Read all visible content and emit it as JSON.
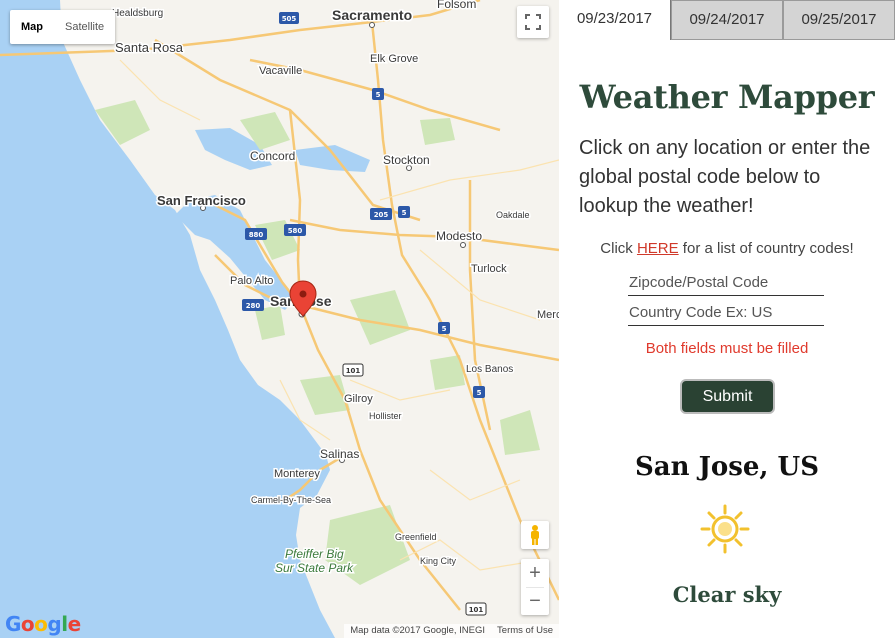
{
  "map": {
    "map_type_buttons": [
      "Map",
      "Satellite"
    ],
    "cities": [
      {
        "name": "Sacramento",
        "style": "big"
      },
      {
        "name": "Folsom",
        "style": "med"
      },
      {
        "name": "Santa Rosa",
        "style": "med"
      },
      {
        "name": "Vacaville",
        "style": "small"
      },
      {
        "name": "Elk Grove",
        "style": "small"
      },
      {
        "name": "Concord",
        "style": "med"
      },
      {
        "name": "Stockton",
        "style": "med"
      },
      {
        "name": "San Francisco",
        "style": "big"
      },
      {
        "name": "Modesto",
        "style": "med"
      },
      {
        "name": "Oakdale",
        "style": "tiny"
      },
      {
        "name": "Turlock",
        "style": "small"
      },
      {
        "name": "Palo Alto",
        "style": "small"
      },
      {
        "name": "San Jose",
        "style": "big"
      },
      {
        "name": "Merced",
        "style": "small"
      },
      {
        "name": "Los Banos",
        "style": "small"
      },
      {
        "name": "Gilroy",
        "style": "small"
      },
      {
        "name": "Hollister",
        "style": "tiny"
      },
      {
        "name": "Salinas",
        "style": "med"
      },
      {
        "name": "Monterey",
        "style": "small"
      },
      {
        "name": "Carmel-By-The-Sea",
        "style": "tiny"
      },
      {
        "name": "Greenfield",
        "style": "tiny"
      },
      {
        "name": "King City",
        "style": "tiny"
      },
      {
        "name": "Pfeiffer Big",
        "style": "park"
      },
      {
        "name": "Sur State Park",
        "style": "park"
      },
      {
        "name": "Healdsburg",
        "style": "tiny"
      }
    ],
    "shields": [
      "505",
      "5",
      "880",
      "580",
      "205",
      "5",
      "280",
      "5",
      "101",
      "5",
      "101",
      "101"
    ],
    "zoom_in": "+",
    "zoom_out": "−",
    "logo": "Google",
    "attribution": [
      "Map data ©2017 Google, INEGI",
      "Terms of Use"
    ]
  },
  "tabs": [
    "09/23/2017",
    "09/24/2017",
    "09/25/2017"
  ],
  "active_tab": 0,
  "title": "Weather Mapper",
  "intro": "Click on any location or enter the global postal code below to lookup the weather!",
  "codes_prefix": "Click ",
  "codes_link": "HERE",
  "codes_suffix": " for a list of country codes!",
  "zip_placeholder": "Zipcode/Postal Code",
  "country_placeholder": "Country Code Ex: US",
  "error": "Both fields must be filled",
  "submit_label": "Submit",
  "result": {
    "location": "San Jose, US",
    "icon": "sun-icon",
    "condition": "Clear sky"
  },
  "colors": {
    "accent": "#2e4b3b",
    "error": "#e03a2d",
    "link": "#d0392a",
    "button": "#2a4233"
  }
}
